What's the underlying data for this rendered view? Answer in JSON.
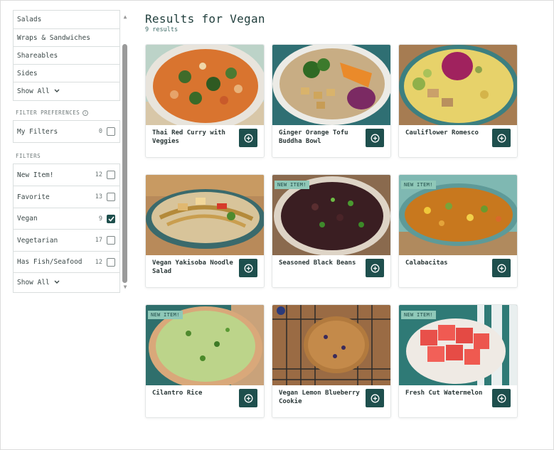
{
  "sidebar": {
    "categories": [
      {
        "label": "Salads"
      },
      {
        "label": "Wraps & Sandwiches"
      },
      {
        "label": "Shareables"
      },
      {
        "label": "Sides"
      }
    ],
    "categories_show_all": "Show All",
    "preferences_title": "FILTER PREFERENCES",
    "my_filters": {
      "label": "My Filters",
      "count": "0"
    },
    "filters_title": "FILTERS",
    "filters": [
      {
        "label": "New Item!",
        "count": "12",
        "checked": false
      },
      {
        "label": "Favorite",
        "count": "13",
        "checked": false
      },
      {
        "label": "Vegan",
        "count": "9",
        "checked": true
      },
      {
        "label": "Vegetarian",
        "count": "17",
        "checked": false
      },
      {
        "label": "Has Fish/Seafood",
        "count": "12",
        "checked": false
      }
    ],
    "filters_show_all": "Show All"
  },
  "main": {
    "title": "Results for Vegan",
    "count": "9 results",
    "badge_text": "NEW ITEM!",
    "items": [
      {
        "name": "Thai Red Curry with Veggies",
        "new": false
      },
      {
        "name": "Ginger Orange Tofu Buddha Bowl",
        "new": false
      },
      {
        "name": "Cauliflower Romesco",
        "new": false
      },
      {
        "name": "Vegan Yakisoba Noodle Salad",
        "new": false
      },
      {
        "name": "Seasoned Black Beans",
        "new": true
      },
      {
        "name": "Calabacitas",
        "new": true
      },
      {
        "name": "Cilantro Rice",
        "new": true
      },
      {
        "name": "Vegan Lemon Blueberry Cookie",
        "new": false
      },
      {
        "name": "Fresh Cut Watermelon",
        "new": true
      }
    ]
  },
  "colors": {
    "accent": "#1e4f4d",
    "badge": "#8fc8b8"
  }
}
